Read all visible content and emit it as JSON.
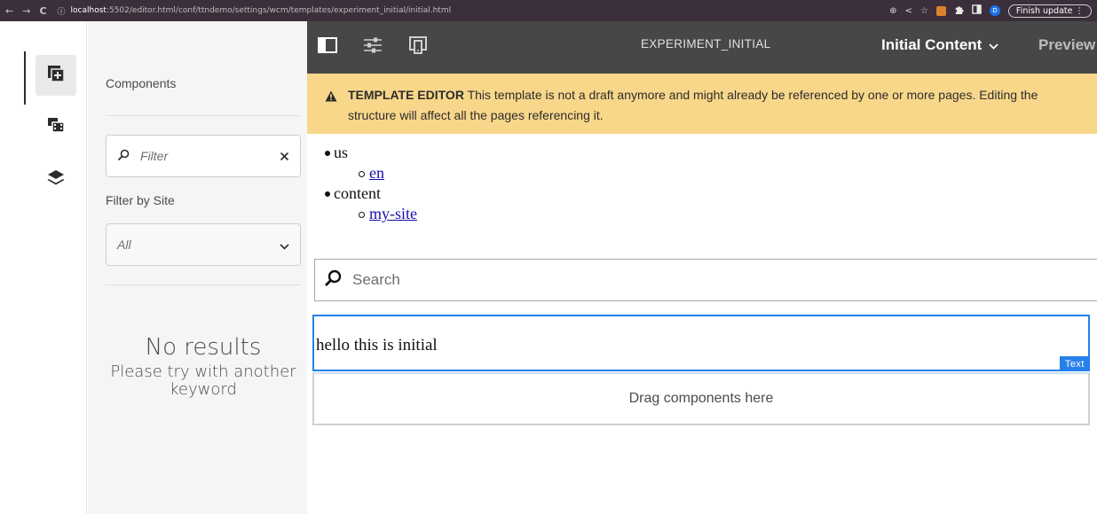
{
  "browser": {
    "back": "←",
    "forward": "→",
    "reload": "C",
    "info": "ⓘ",
    "host": "localhost",
    "path": ":5502/editor.html/conf/ttndemo/settings/wcm/templates/experiment_initial/initial.html",
    "zoom_icon": "⊕",
    "share_icon": "<",
    "star_icon": "☆",
    "profile_letter": "D",
    "finish_update": "Finish update",
    "menu_icon": "⋮"
  },
  "rail": {
    "items": [
      {
        "name": "components",
        "active": true
      },
      {
        "name": "assets",
        "active": false
      },
      {
        "name": "content-tree",
        "active": false
      }
    ]
  },
  "panel": {
    "title": "Components",
    "filter_placeholder": "Filter",
    "filter_by_site_label": "Filter by Site",
    "site_select_value": "All",
    "no_results": "No results",
    "no_results_hint_line1": "Please try with another",
    "no_results_hint_line2": "keyword"
  },
  "toolbar": {
    "page_title": "EXPERIMENT_INITIAL",
    "mode_label": "Initial Content",
    "preview_label": "Preview"
  },
  "banner": {
    "heading": "TEMPLATE EDITOR",
    "message": "This template is not a draft anymore and might already be referenced by one or more pages. Editing the structure will affect all the pages referencing it."
  },
  "content": {
    "tree": [
      {
        "label": "us",
        "child": "en"
      },
      {
        "label": "content",
        "child": "my-site"
      }
    ],
    "search_placeholder": "Search",
    "text_component_value": "hello this is initial",
    "text_component_tag": "Text",
    "drop_zone_label": "Drag components here"
  },
  "colors": {
    "toolbar_bg": "#474747",
    "banner_bg": "#f9d78a",
    "selection_blue": "#2680eb",
    "panel_bg": "#f5f5f5"
  }
}
